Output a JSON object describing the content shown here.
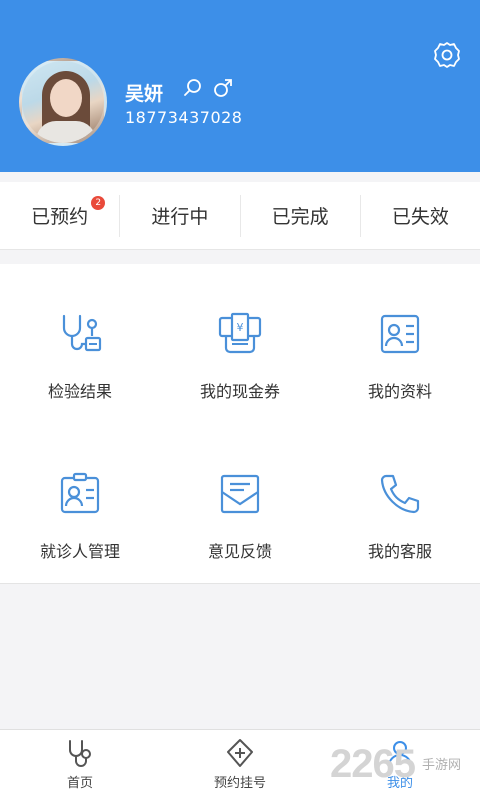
{
  "colors": {
    "primary": "#3d8fe8",
    "badge": "#e94a3a",
    "icon": "#4a90d9"
  },
  "header": {
    "name": "吴妍",
    "phone": "18773437028",
    "icons": [
      "search-icon",
      "male-icon",
      "settings-icon"
    ]
  },
  "status": {
    "items": [
      {
        "label": "已预约",
        "badge": "2"
      },
      {
        "label": "进行中"
      },
      {
        "label": "已完成"
      },
      {
        "label": "已失效"
      }
    ]
  },
  "grid": {
    "items": [
      {
        "label": "检验结果",
        "icon": "stethoscope-report-icon"
      },
      {
        "label": "我的现金券",
        "icon": "coupon-icon"
      },
      {
        "label": "我的资料",
        "icon": "profile-card-icon"
      },
      {
        "label": "就诊人管理",
        "icon": "patient-badge-icon"
      },
      {
        "label": "意见反馈",
        "icon": "feedback-envelope-icon"
      },
      {
        "label": "我的客服",
        "icon": "phone-icon"
      }
    ]
  },
  "tabs": [
    {
      "label": "首页",
      "icon": "stethoscope-icon"
    },
    {
      "label": "预约挂号",
      "icon": "medical-cross-icon"
    },
    {
      "label": "我的",
      "icon": "person-icon",
      "active": true
    }
  ],
  "watermark": {
    "text": "2265",
    "site": "手游网"
  }
}
